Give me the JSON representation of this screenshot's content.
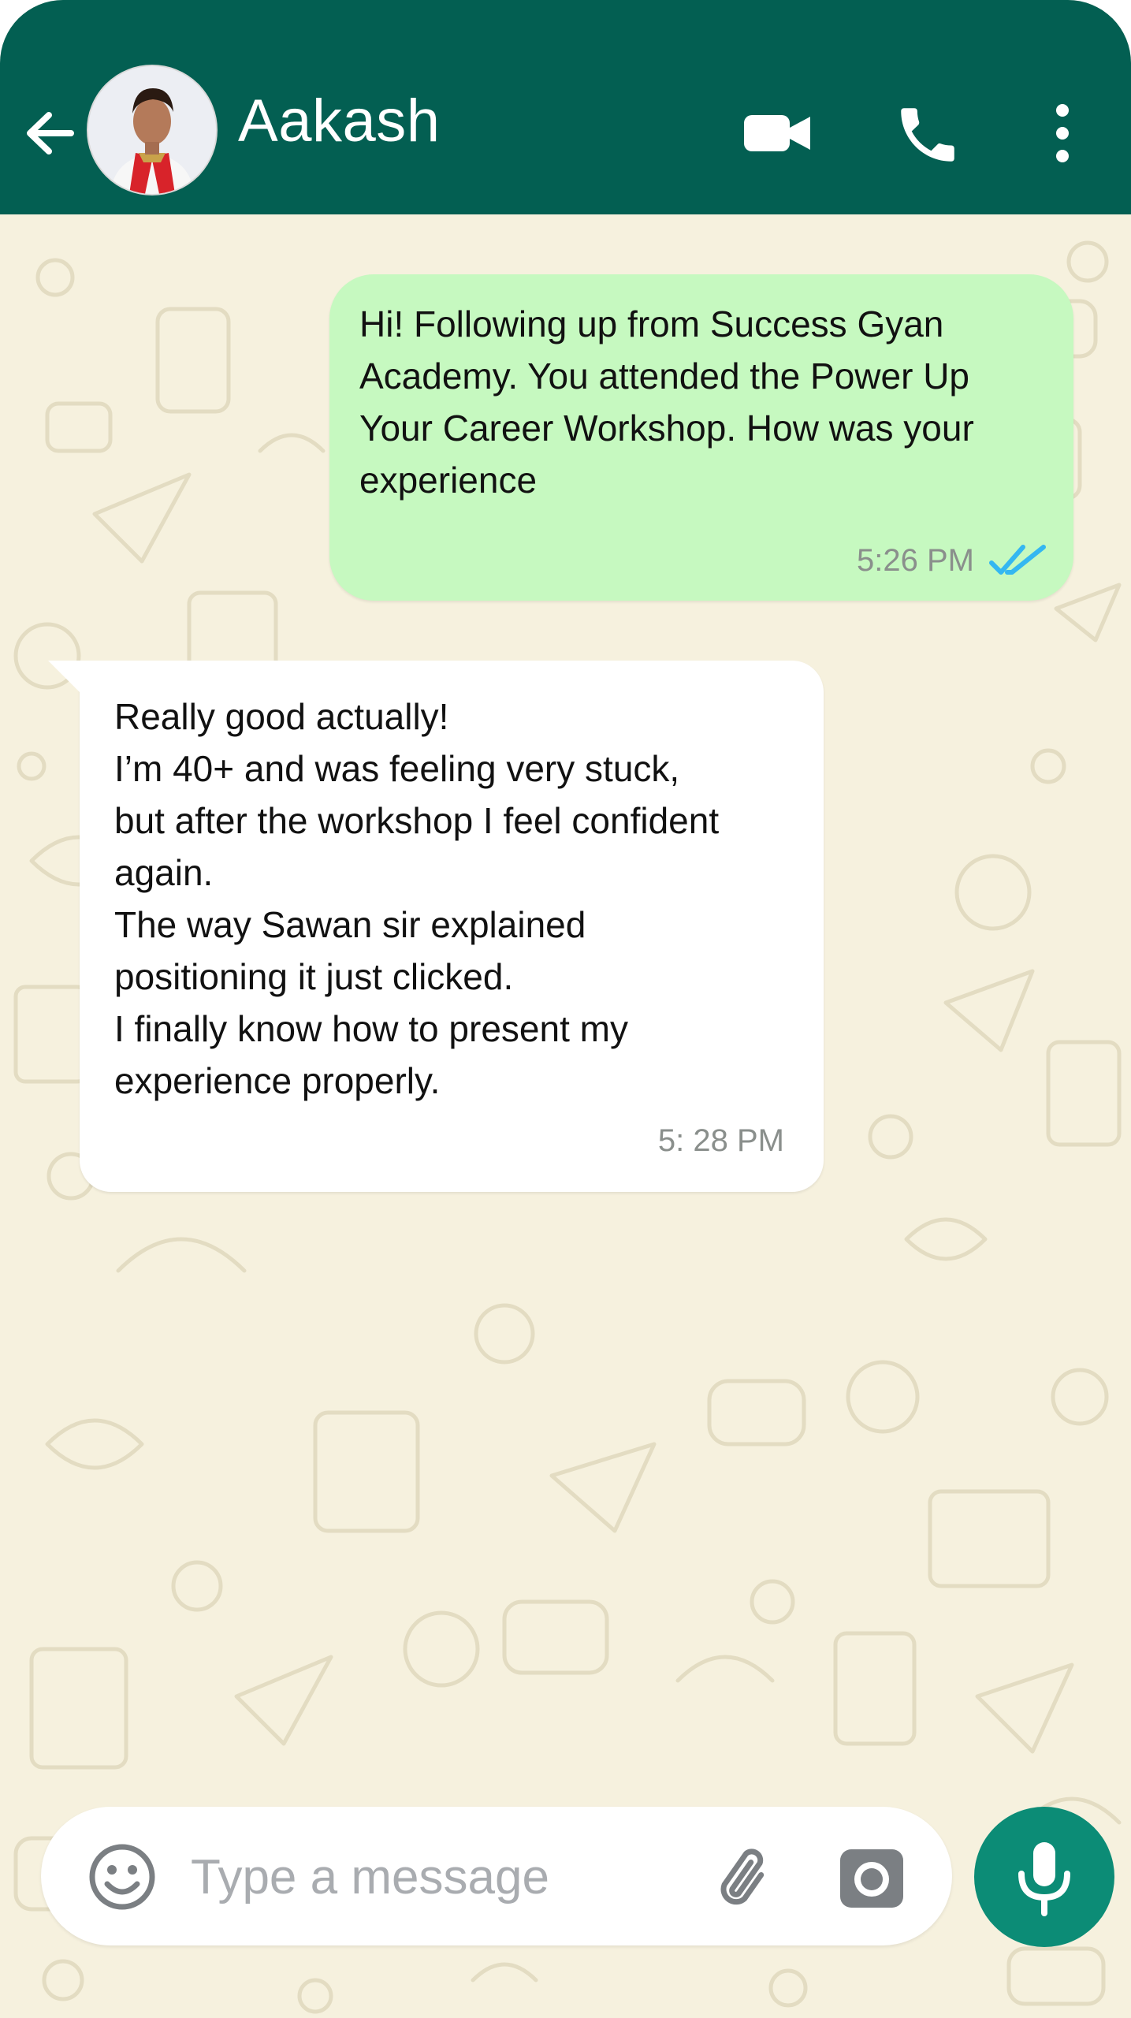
{
  "header": {
    "contact_name": "Aakash",
    "bg_color": "#035f52",
    "icons": [
      "back-arrow-icon",
      "video-call-icon",
      "phone-icon",
      "more-vert-icon"
    ]
  },
  "messages": [
    {
      "direction": "outgoing",
      "text": "Hi! Following up from Success Gyan\nAcademy. You attended the Power Up\nYour Career Workshop. How was your\nexperience",
      "time": "5:26 PM",
      "status": "read",
      "bubble_color": "#c6f9c0"
    },
    {
      "direction": "incoming",
      "text": "Really good actually!\nI’m 40+ and was feeling very stuck,\nbut after the workshop I feel confident\nagain.\nThe way Sawan sir explained\npositioning it just clicked.\nI finally know how to present my\nexperience properly.",
      "time": "5: 28 PM",
      "bubble_color": "#ffffff"
    }
  ],
  "composer": {
    "placeholder": "Type a message",
    "value": "",
    "icons": [
      "emoji-icon",
      "paperclip-icon",
      "camera-icon",
      "microphone-icon"
    ],
    "mic_color": "#0c8c76"
  },
  "colors": {
    "wallpaper": "#f6f1de",
    "read_ticks": "#34b7f1"
  }
}
